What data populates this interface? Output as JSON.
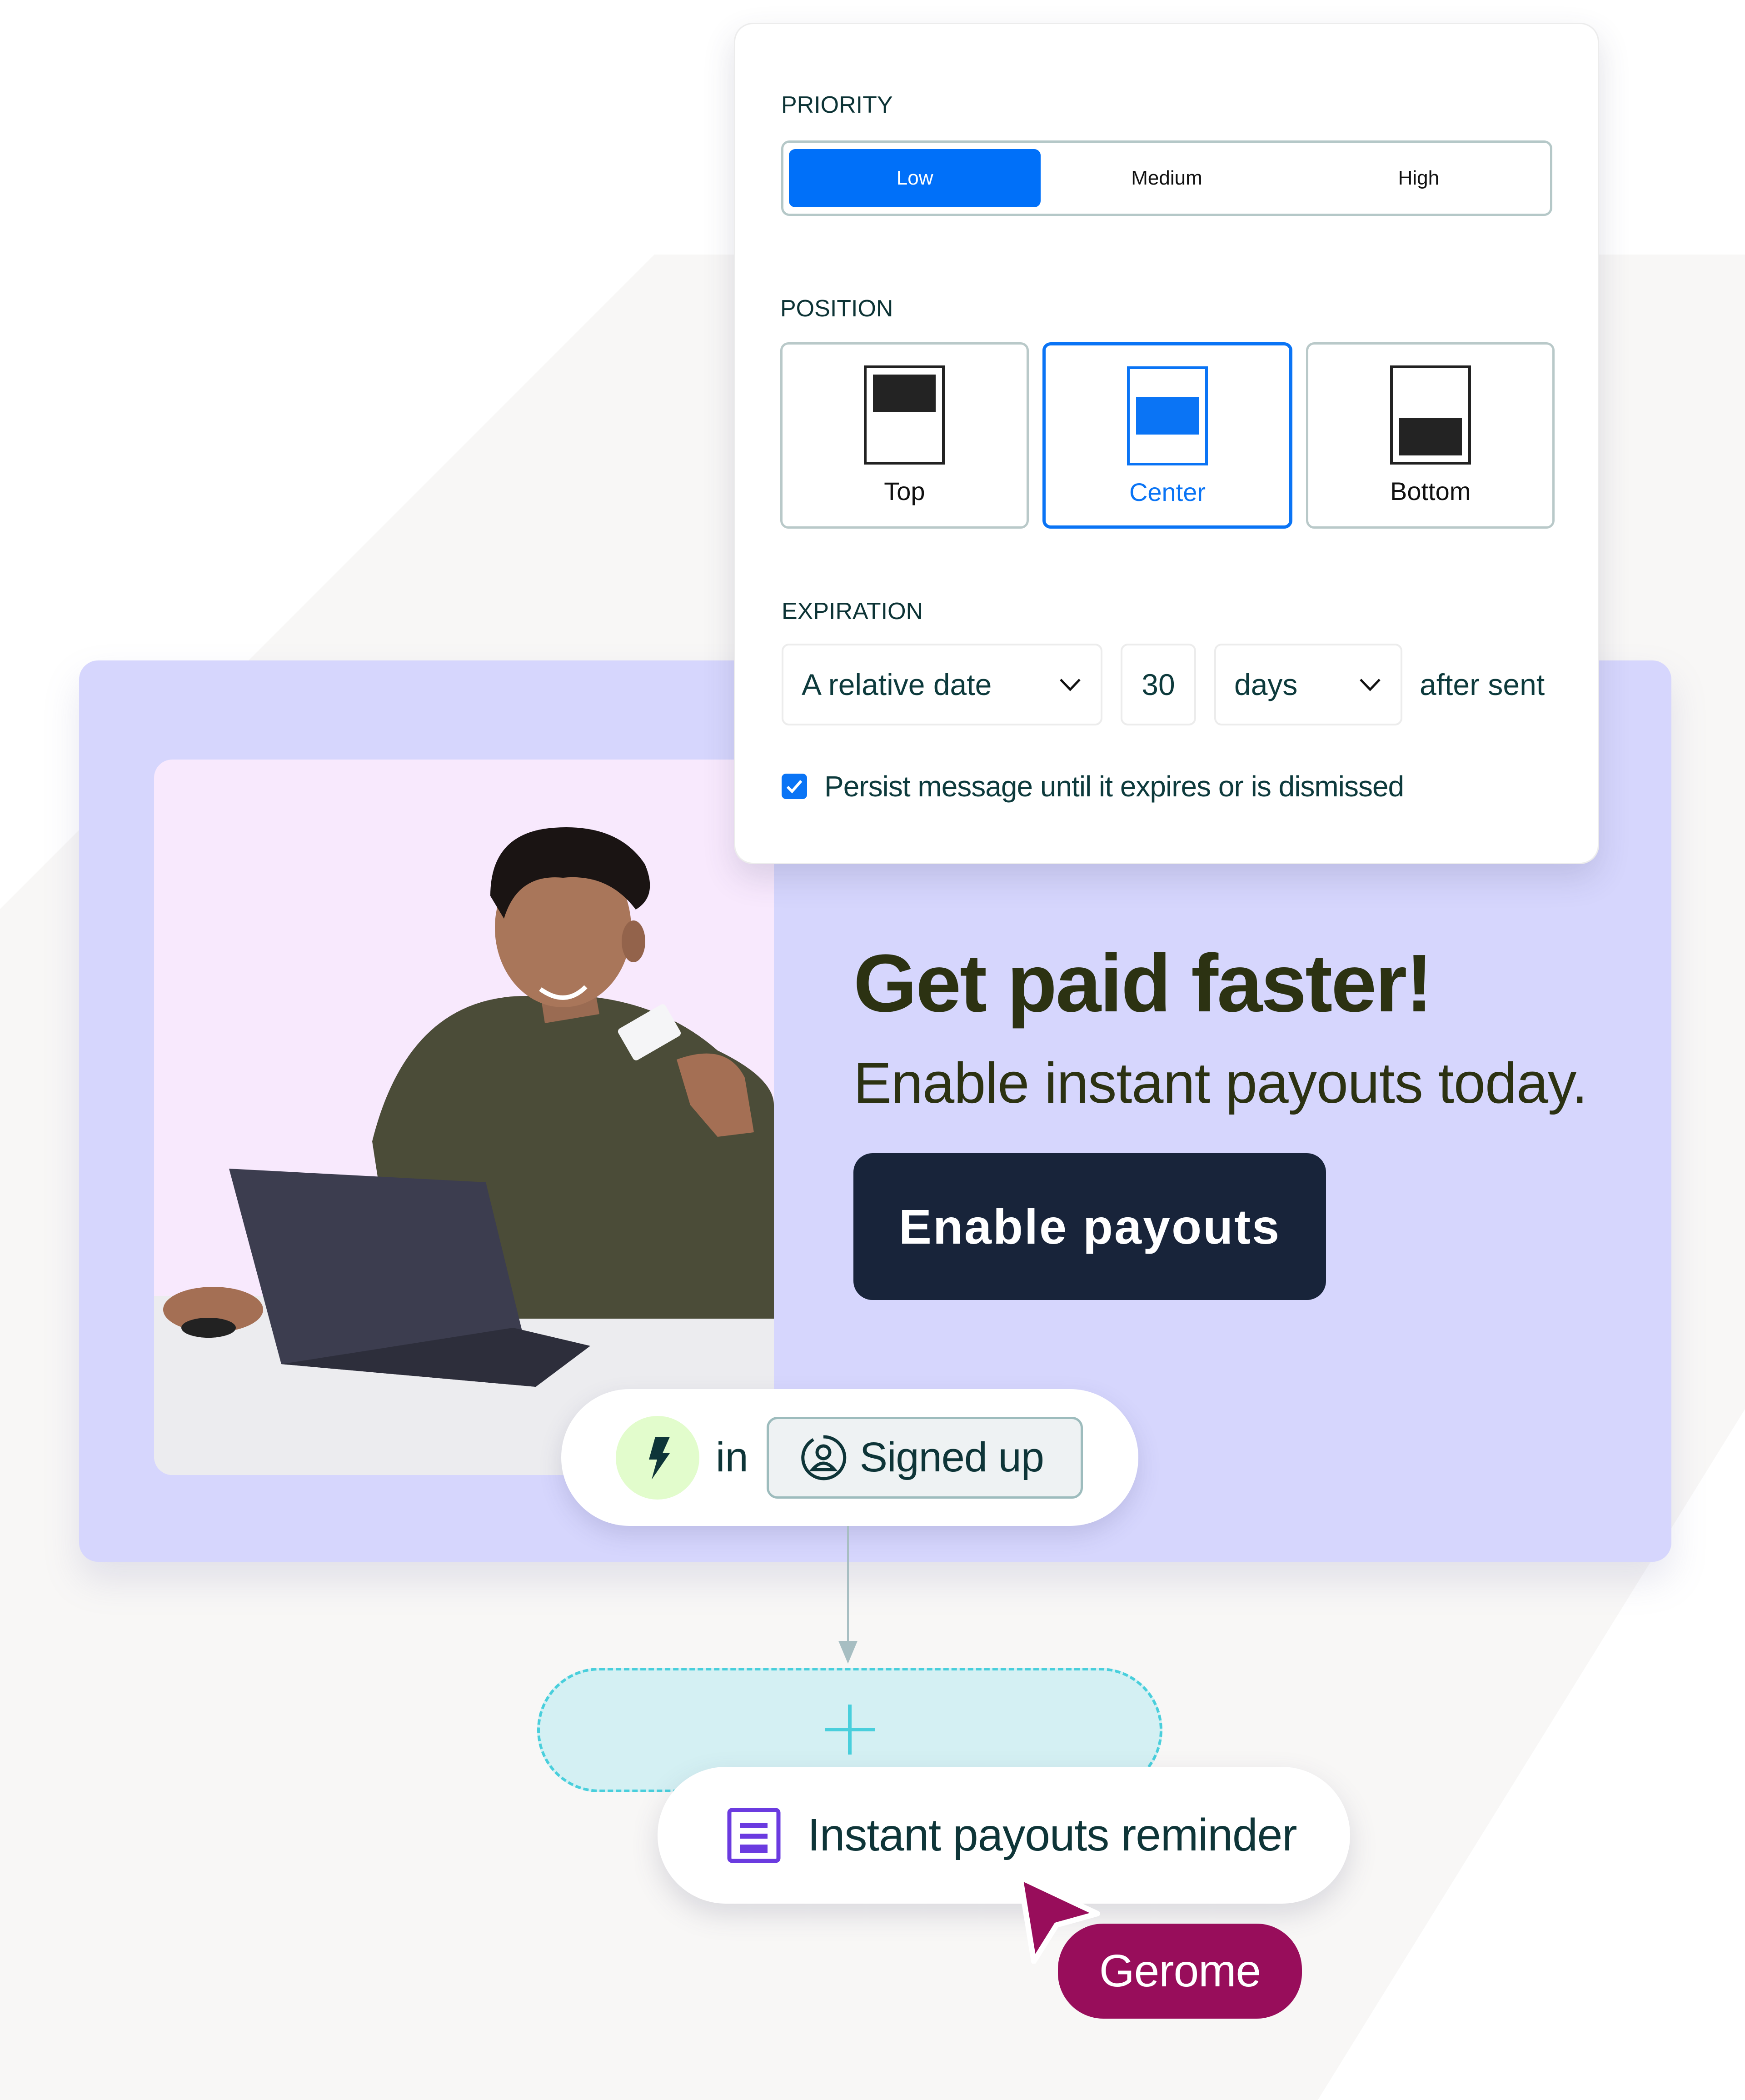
{
  "settings_panel": {
    "priority": {
      "label": "PRIORITY",
      "options": [
        "Low",
        "Medium",
        "High"
      ],
      "selected": "Low"
    },
    "position": {
      "label": "POSITION",
      "options": [
        "Top",
        "Center",
        "Bottom"
      ],
      "selected": "Center"
    },
    "expiration": {
      "label": "EXPIRATION",
      "mode_select": "A relative date",
      "amount": "30",
      "unit_select": "days",
      "suffix": "after sent"
    },
    "persist": {
      "checked": true,
      "label": "Persist message until it expires or is dismissed"
    }
  },
  "promo": {
    "headline": "Get paid faster!",
    "subline": "Enable instant payouts today.",
    "cta_label": "Enable payouts",
    "photo_description": "man smiling at laptop holding a payment card"
  },
  "workflow": {
    "trigger": {
      "icon": "lightning-bolt-icon",
      "connector_word": "in",
      "segment_icon": "user-circle-icon",
      "segment_label": "Signed up"
    },
    "add_step": {
      "icon": "plus-icon"
    },
    "step": {
      "icon": "message-document-icon",
      "label": "Instant payouts reminder"
    },
    "collaborator_cursor": {
      "name": "Gerome"
    }
  },
  "colors": {
    "primary_blue": "#0070f9",
    "promo_lavender": "#d6d6fd",
    "photo_pink": "#f8e9fd",
    "headline_olive": "#2c3212",
    "cta_navy": "#18243a",
    "teal_text": "#0e3538",
    "bolt_green": "#e2fccc",
    "add_slot_cyan": "#d4f0f3",
    "dashed_cyan": "#49cfdc",
    "doc_purple": "#6b3be0",
    "cursor_magenta": "#980d5b"
  }
}
